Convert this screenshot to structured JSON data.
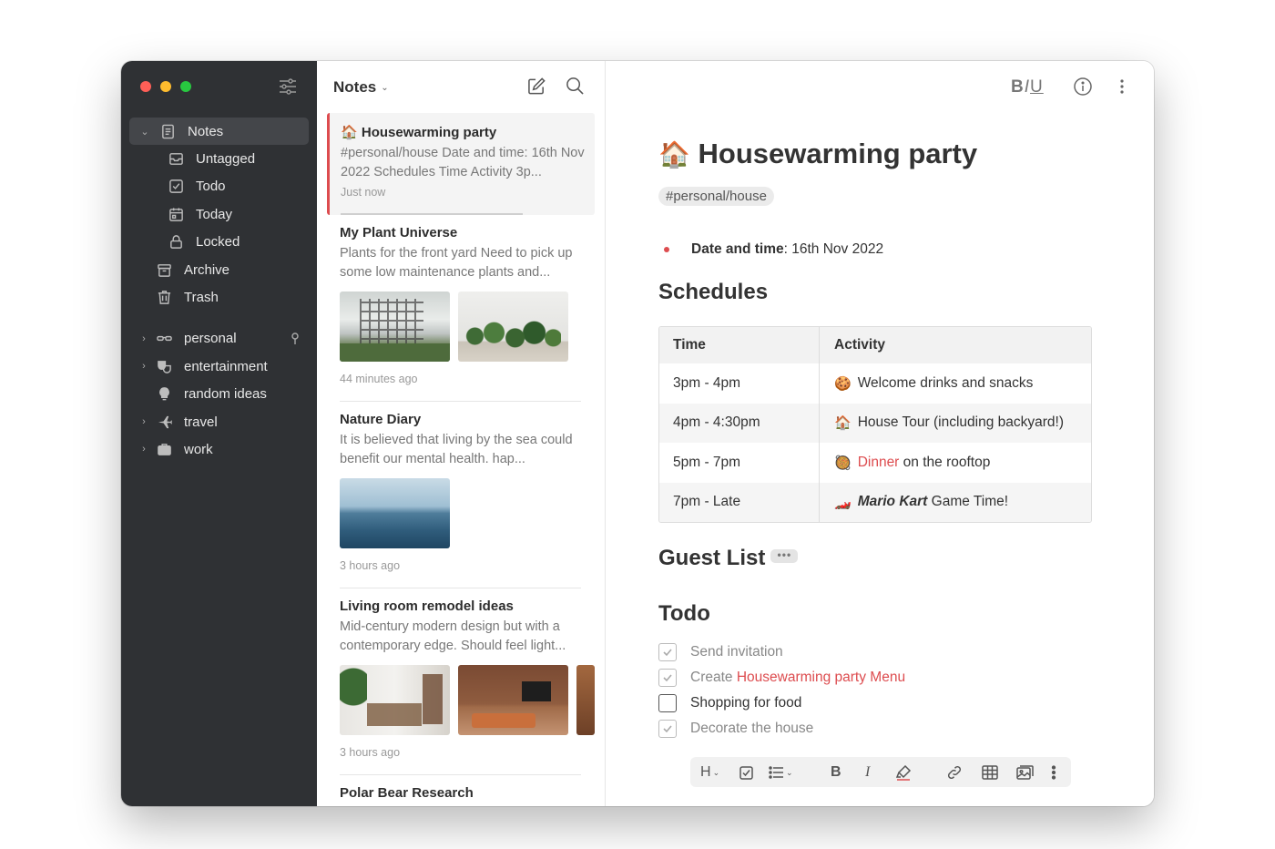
{
  "sidebar": {
    "items": [
      {
        "label": "Notes",
        "icon": "note-icon"
      },
      {
        "label": "Untagged",
        "icon": "inbox-icon"
      },
      {
        "label": "Todo",
        "icon": "checkbox-icon"
      },
      {
        "label": "Today",
        "icon": "calendar-icon"
      },
      {
        "label": "Locked",
        "icon": "lock-icon"
      },
      {
        "label": "Archive",
        "icon": "archive-icon"
      },
      {
        "label": "Trash",
        "icon": "trash-icon"
      }
    ],
    "tags": [
      {
        "label": "personal",
        "icon": "glasses-icon"
      },
      {
        "label": "entertainment",
        "icon": "theater-masks-icon"
      },
      {
        "label": "random ideas",
        "icon": "lightbulb-icon"
      },
      {
        "label": "travel",
        "icon": "airplane-icon"
      },
      {
        "label": "work",
        "icon": "briefcase-icon"
      }
    ]
  },
  "notelist": {
    "title": "Notes",
    "notes": [
      {
        "emoji": "🏠",
        "title": "Housewarming party",
        "preview": "#personal/house Date and time: 16th Nov 2022 Schedules Time Activity 3p...",
        "time": "Just now"
      },
      {
        "title": "My Plant Universe",
        "preview": "Plants for the front yard Need to pick up some low maintenance plants and...",
        "time": "44 minutes ago"
      },
      {
        "title": "Nature Diary",
        "preview": "It is believed that living by the sea could benefit our mental health. hap...",
        "time": "3 hours ago"
      },
      {
        "title": "Living room remodel ideas",
        "preview": "Mid-century modern design but with a contemporary edge. Should feel light...",
        "time": "3 hours ago"
      },
      {
        "title": "Polar Bear Research"
      }
    ]
  },
  "editor": {
    "toolbar": {
      "b": "B",
      "i": "I",
      "u": "U"
    },
    "title_emoji": "🏠",
    "title": "Housewarming party",
    "tag": "#personal/house",
    "bullet": {
      "label": "Date and time",
      "sep": ":",
      "value": " 16th Nov 2022"
    },
    "schedules_heading": "Schedules",
    "table": {
      "headers": [
        "Time",
        "Activity"
      ],
      "rows": [
        {
          "time": "3pm - 4pm",
          "emoji": "🍪",
          "pre": "",
          "link": "",
          "text": "Welcome drinks and snacks"
        },
        {
          "time": "4pm - 4:30pm",
          "emoji": "🏠",
          "pre": "",
          "link": "",
          "text": "House Tour (including backyard!)"
        },
        {
          "time": "5pm - 7pm",
          "emoji": "🥘",
          "pre": "",
          "link": "Dinner",
          "text": " on the rooftop"
        },
        {
          "time": "7pm - Late",
          "emoji": "🏎️",
          "pre": "Mario Kart",
          "link": "",
          "text": " Game Time!"
        }
      ]
    },
    "guest_heading": "Guest List",
    "guest_more": "•••",
    "todo_heading": "Todo",
    "todos": [
      {
        "text": "Send invitation",
        "link": "",
        "done": true
      },
      {
        "text": "Create ",
        "link": "Housewarming party Menu",
        "done": true
      },
      {
        "text": "Shopping for food",
        "link": "",
        "done": false
      },
      {
        "text": "Decorate the house",
        "link": "",
        "done": true
      }
    ],
    "format_bar": {
      "heading": "H",
      "bold": "B",
      "italic": "I"
    }
  },
  "colors": {
    "accent": "#dd4c4f",
    "sidebar_bg": "#2f3134"
  }
}
